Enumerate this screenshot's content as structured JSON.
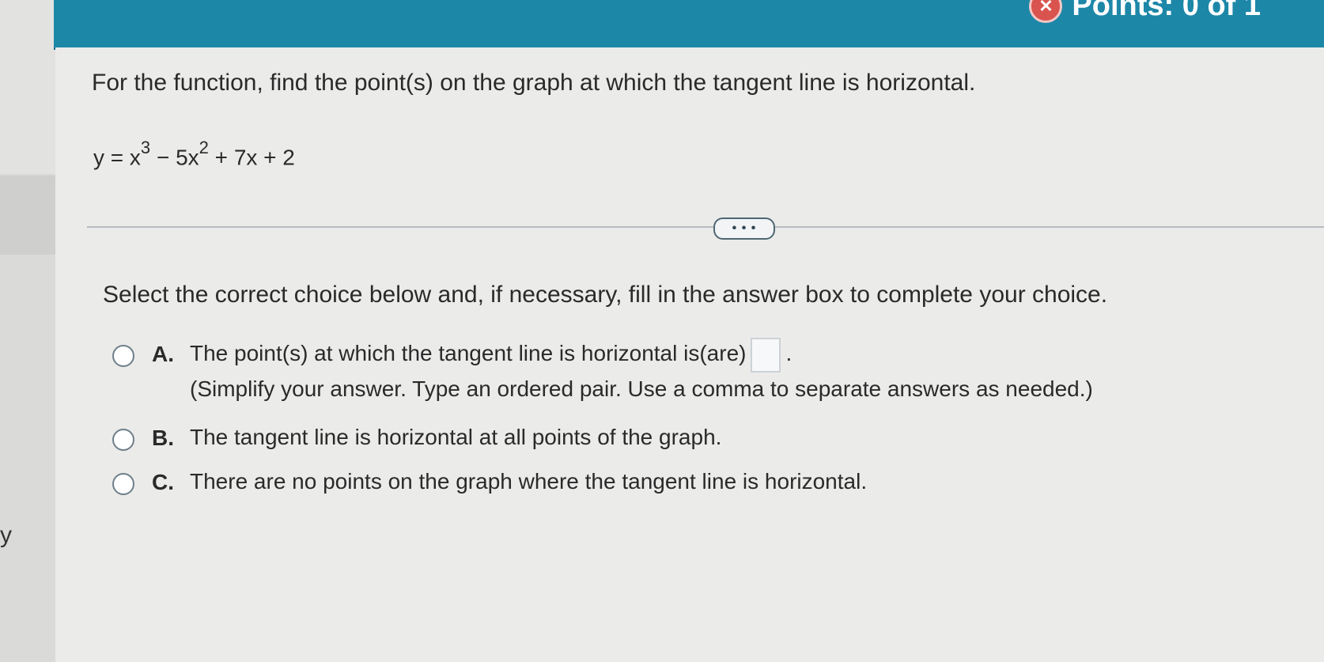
{
  "header": {
    "points_text": "Points: 0 of 1",
    "status_icon": "close-circle-icon",
    "color": "#1d87a8"
  },
  "sidebar": {
    "partial_text": "y"
  },
  "question": {
    "prompt": "For the function, find the point(s) on the graph at which the tangent line is horizontal.",
    "equation": {
      "lhs": "y = x",
      "exp1": "3",
      "mid1": " − 5x",
      "exp2": "2",
      "rest": " + 7x + 2"
    }
  },
  "toolbar": {
    "more_label": "• • •"
  },
  "instruction": "Select the correct choice below and, if necessary, fill in the answer box to complete your choice.",
  "choices": [
    {
      "letter": "A.",
      "text": "The point(s) at which the tangent line is horizontal is(are)",
      "suffix": ".",
      "hint": "(Simplify your answer. Type an ordered pair. Use a comma to separate answers as needed.)",
      "answer_value": ""
    },
    {
      "letter": "B.",
      "text": "The tangent line is horizontal at all points of the graph."
    },
    {
      "letter": "C.",
      "text": "There are no points on the graph where the tangent line is horizontal."
    }
  ]
}
